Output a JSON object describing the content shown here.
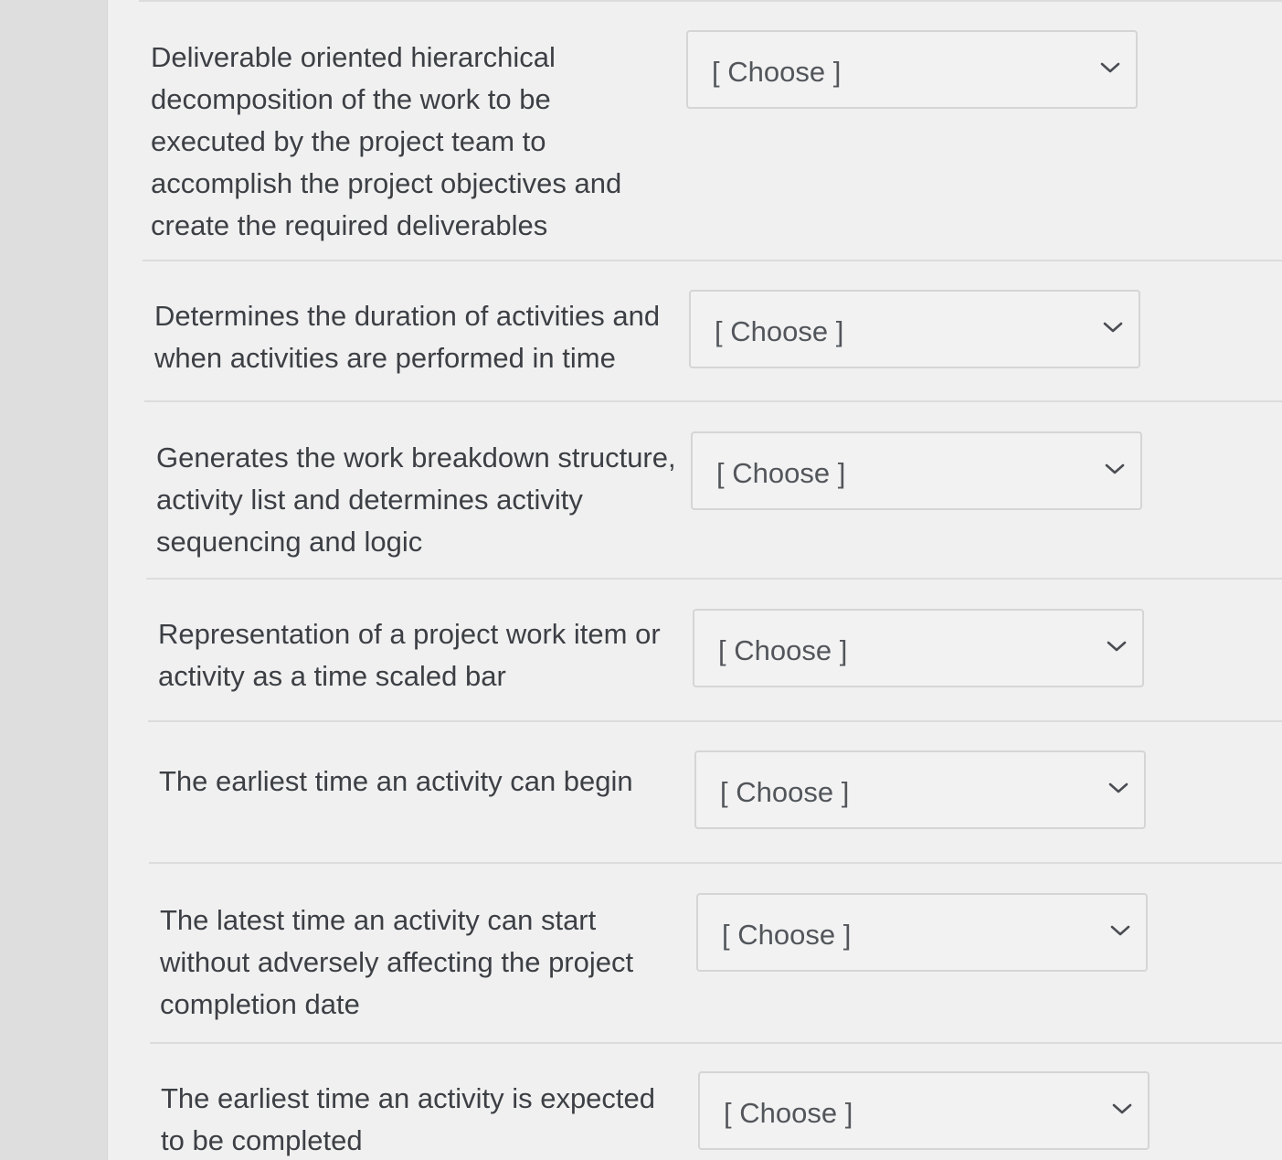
{
  "questions": [
    {
      "prompt": "Deliverable oriented hierarchical decomposition of the work to be executed by the project team to accomplish the project objectives and create the required deliverables",
      "selected": "[ Choose ]"
    },
    {
      "prompt": "Determines the duration of activities and when activities are performed in time",
      "selected": "[ Choose ]"
    },
    {
      "prompt": "Generates the work breakdown structure, activity list and determines activity sequencing and logic",
      "selected": "[ Choose ]"
    },
    {
      "prompt": "Representation of a project work item or activity as a time scaled bar",
      "selected": "[ Choose ]"
    },
    {
      "prompt": "The earliest time an activity can begin",
      "selected": "[ Choose ]"
    },
    {
      "prompt": "The latest time an activity can start without adversely affecting the project completion date",
      "selected": "[ Choose ]"
    },
    {
      "prompt": "The earliest time an activity is expected to be completed",
      "selected": "[ Choose ]"
    }
  ],
  "icons": {
    "dropdown": "chevron-down-icon"
  }
}
